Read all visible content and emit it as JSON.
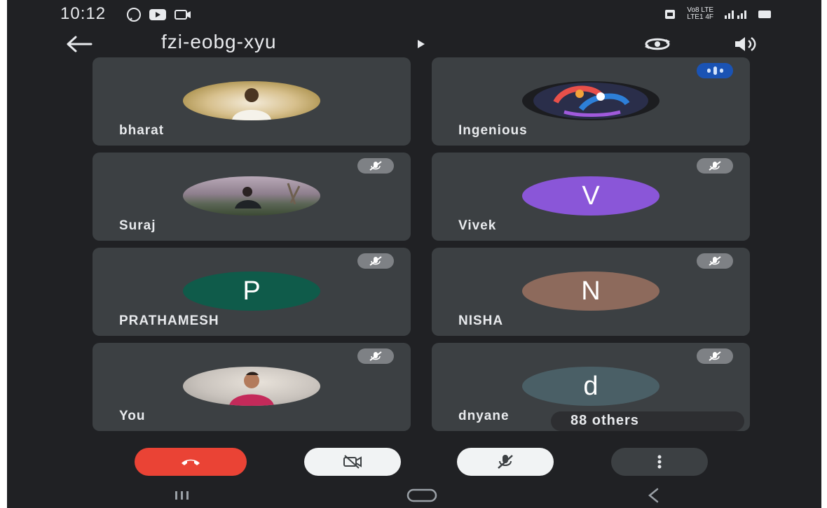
{
  "status_bar": {
    "time": "10:12",
    "network_text": "Vo8 LTE\nLTE1 4F"
  },
  "top_bar": {
    "meeting_code": "fzi-eobg-xyu"
  },
  "participants": [
    {
      "name": "bharat",
      "avatar_type": "photo",
      "muted": false,
      "speaking": false
    },
    {
      "name": "Ingenious",
      "avatar_type": "logo",
      "muted": false,
      "speaking": true
    },
    {
      "name": "Suraj",
      "avatar_type": "photo",
      "muted": true,
      "speaking": false
    },
    {
      "name": "Vivek",
      "avatar_type": "initial",
      "initial": "V",
      "avatar_color": "#8a56d8",
      "muted": true
    },
    {
      "name": "PRATHAMESH",
      "avatar_type": "initial",
      "initial": "P",
      "avatar_color": "#0f5b4a",
      "muted": true
    },
    {
      "name": "NISHA",
      "avatar_type": "initial",
      "initial": "N",
      "avatar_color": "#8d6a5c",
      "muted": true
    },
    {
      "name": "You",
      "avatar_type": "photo",
      "muted": true,
      "speaking": false
    },
    {
      "name": "dnyane",
      "avatar_type": "initial",
      "initial": "d",
      "avatar_color": "#4a5f66",
      "muted": true
    }
  ],
  "others": {
    "label": "88 others"
  },
  "controls": {
    "end_call_icon": "phone-hangup-icon",
    "camera_icon": "camera-off-icon",
    "mic_icon": "mic-off-icon",
    "more_icon": "more-vert-icon",
    "end_call_color": "#ea4335"
  },
  "nav": {
    "recents_icon": "recents-icon",
    "home_icon": "home-icon",
    "back_icon": "back-nav-icon"
  }
}
